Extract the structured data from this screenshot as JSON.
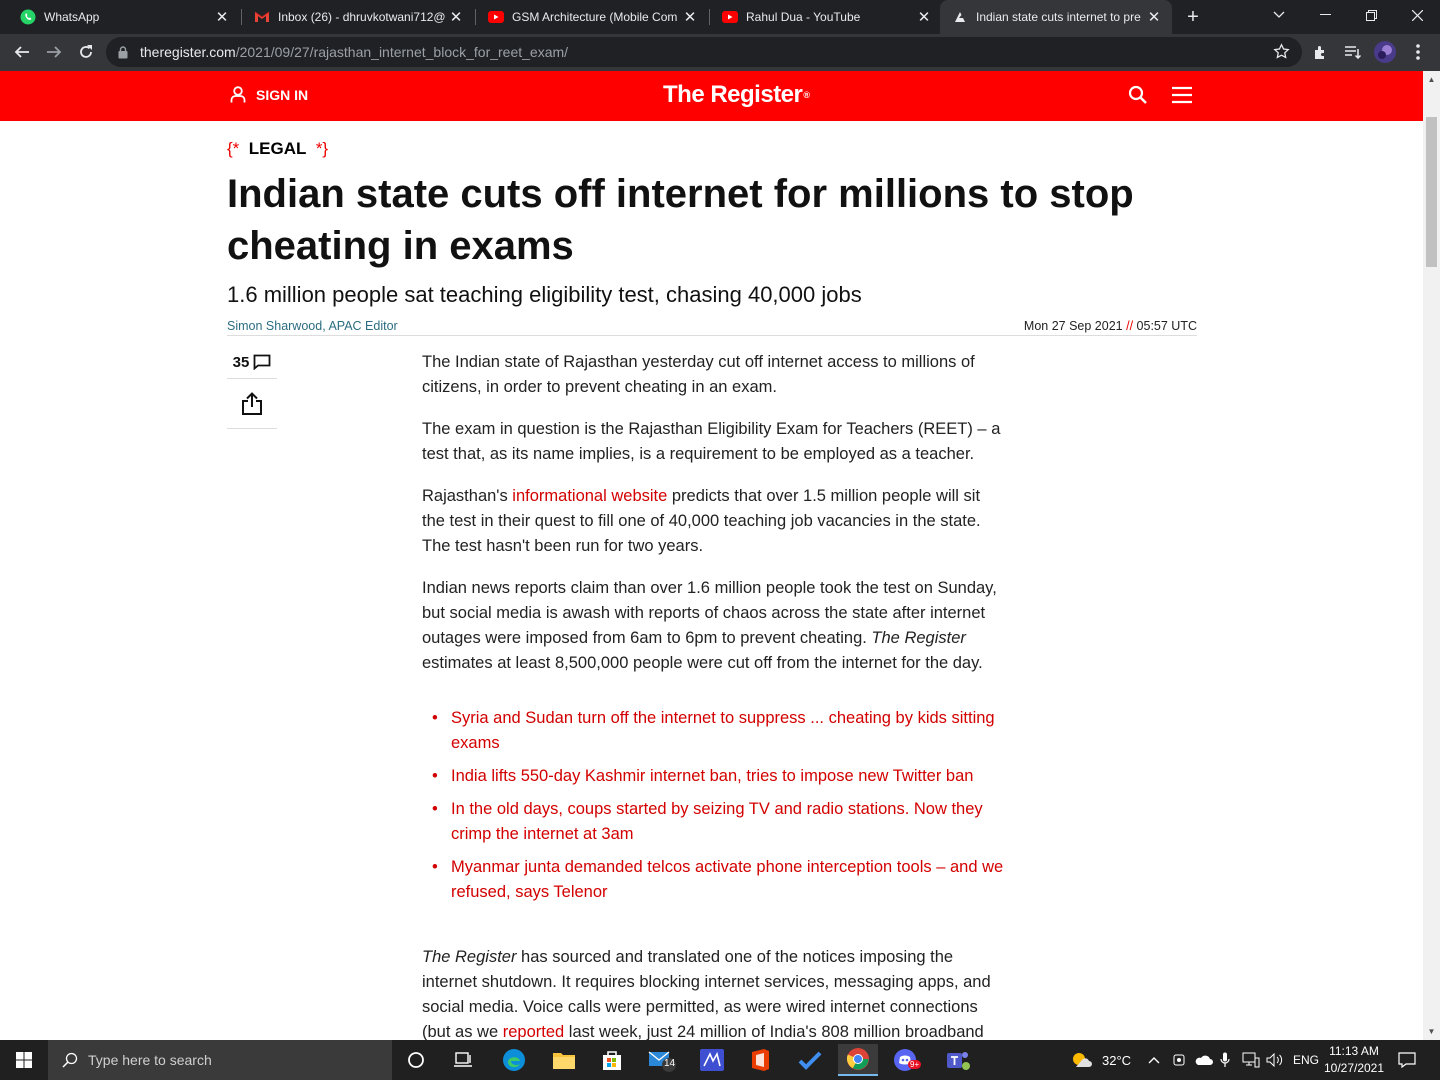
{
  "browser": {
    "tabs": [
      {
        "title": "WhatsApp",
        "icon": "whatsapp-icon",
        "active": false
      },
      {
        "title": "Inbox (26) - dhruvkotwani712@",
        "icon": "gmail-icon",
        "active": false
      },
      {
        "title": "GSM Architecture (Mobile Com",
        "icon": "youtube-icon",
        "active": false
      },
      {
        "title": "Rahul Dua - YouTube",
        "icon": "youtube-icon",
        "active": false
      },
      {
        "title": "Indian state cuts internet to pre",
        "icon": "register-icon",
        "active": true
      }
    ],
    "url_host": "theregister.com",
    "url_path": "/2021/09/27/rajasthan_internet_block_for_reet_exam/"
  },
  "site": {
    "sign_in": "SIGN IN",
    "logo_text": "The Register",
    "brand_color": "#ff0000"
  },
  "article": {
    "kicker_open": "{*",
    "kicker": "LEGAL",
    "kicker_close": "*}",
    "headline": "Indian state cuts off internet for millions to stop cheating in exams",
    "standfirst": "1.6 million people sat teaching eligibility test, chasing 40,000 jobs",
    "author": "Simon Sharwood, APAC Editor",
    "date": "Mon 27 Sep 2021",
    "date_sep": "//",
    "time": "05:57 UTC",
    "comment_count": "35",
    "p1": "The Indian state of Rajasthan yesterday cut off internet access to millions of citizens, in order to prevent cheating in an exam.",
    "p2": "The exam in question is the Rajasthan Eligibility Exam for Teachers (REET) – a test that, as its name implies, is a requirement to be employed as a teacher.",
    "p3_before": "Rajasthan's ",
    "p3_link": "informational website",
    "p3_after": " predicts that over 1.5 million people will sit the test in their quest to fill one of 40,000 teaching job vacancies in the state. The test hasn't been run for two years.",
    "p4_before": "Indian news reports claim than over 1.6 million people took the test on Sunday, but social media is awash with reports of chaos across the state after internet outages were imposed from 6am to 6pm to prevent cheating. ",
    "p4_italic": "The Register",
    "p4_after": " estimates at least 8,500,000 people were cut off from the internet for the day.",
    "related": [
      "Syria and Sudan turn off the internet to suppress ... cheating by kids sitting exams",
      "India lifts 550-day Kashmir internet ban, tries to impose new Twitter ban",
      "In the old days, coups started by seizing TV and radio stations. Now they crimp the internet at 3am",
      "Myanmar junta demanded telcos activate phone interception tools – and we refused, says Telenor"
    ],
    "p5_italic": "The Register",
    "p5_mid": " has sourced and translated one of the notices imposing the internet shutdown. It requires blocking internet services, messaging apps, and social media. Voice calls were permitted, as were wired internet connections (but as we ",
    "p5_link": "reported",
    "p5_after": " last week, just 24 million of India's 808 million broadband"
  },
  "taskbar": {
    "search_placeholder": "Type here to search",
    "mail_badge": "14",
    "discord_badge": "9+",
    "weather": "32°C",
    "language": "ENG",
    "time": "11:13 AM",
    "date": "10/27/2021"
  }
}
